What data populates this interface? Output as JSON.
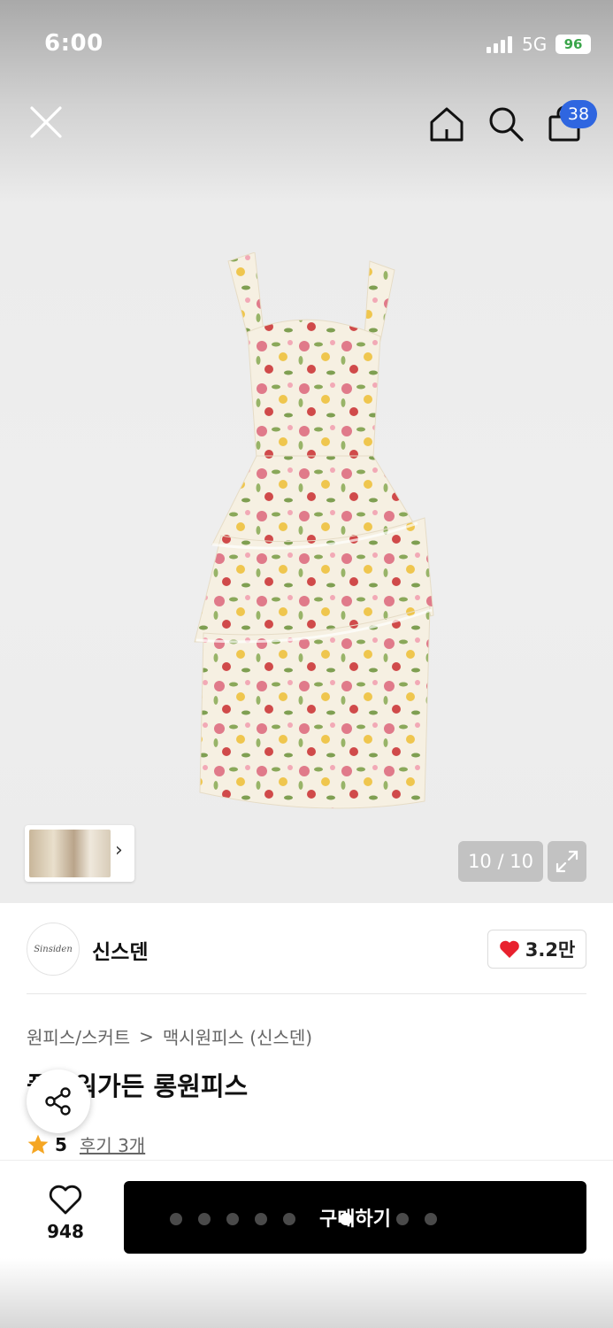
{
  "status_bar": {
    "time": "6:00",
    "network": "5G",
    "battery": "96"
  },
  "topnav": {
    "close_icon": "close-icon",
    "home_icon": "home-icon",
    "search_icon": "search-icon",
    "bag_icon": "shopping-bag-icon",
    "bag_count": "38"
  },
  "gallery": {
    "counter": "10 / 10",
    "thumb_arrow": "›",
    "expand_icon": "expand-icon"
  },
  "brand": {
    "logo_text": "Sinsiden",
    "name": "신스덴",
    "likes": "3.2만"
  },
  "product": {
    "breadcrumb": [
      "원피스/스커트",
      "맥시원피스 (신스덴)"
    ],
    "breadcrumb_sep": ">",
    "title": "플라워가든 롱원피스",
    "rating": "5",
    "reviews": "후기 3개"
  },
  "bottom": {
    "wish_count": "948",
    "buy_label": "구매하기"
  },
  "colors": {
    "accent_blue": "#2f66e0",
    "heart_red": "#e8212e",
    "star_orange": "#f5a623",
    "buy_bg": "#000000"
  }
}
